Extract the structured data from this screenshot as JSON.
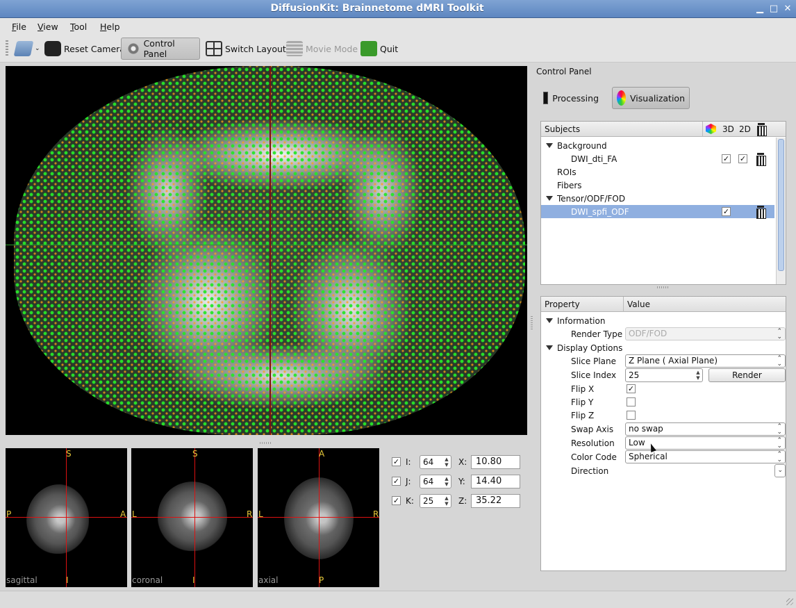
{
  "window": {
    "title": "DiffusionKit: Brainnetome dMRI Toolkit"
  },
  "menu": [
    "File",
    "View",
    "Tool",
    "Help"
  ],
  "toolbar": {
    "reset_camera": "Reset Camera",
    "control_panel": "Control Panel",
    "switch_layout": "Switch Layout",
    "movie_mode": "Movie Mode",
    "quit": "Quit"
  },
  "views": {
    "sagittal": {
      "label": "sagittal",
      "top": "S",
      "bottom": "I",
      "left": "P",
      "right": "A"
    },
    "coronal": {
      "label": "coronal",
      "top": "S",
      "bottom": "I",
      "left": "L",
      "right": "R"
    },
    "axial": {
      "label": "axial",
      "top": "A",
      "bottom": "P",
      "left": "L",
      "right": "R"
    }
  },
  "coords": {
    "i_label": "I:",
    "i_value": "64",
    "x_label": "X:",
    "x_value": "10.80",
    "j_label": "J:",
    "j_value": "64",
    "y_label": "Y:",
    "y_value": "14.40",
    "k_label": "K:",
    "k_value": "25",
    "z_label": "Z:",
    "z_value": "35.22",
    "checked": "✓"
  },
  "control_panel": {
    "title": "Control Panel",
    "processing": "Processing",
    "visualization": "Visualization",
    "subjects": {
      "header": "Subjects",
      "col_3d": "3D",
      "col_2d": "2D",
      "background": "Background",
      "dwi_dti_fa": "DWI_dti_FA",
      "rois": "ROIs",
      "fibers": "Fibers",
      "tensor": "Tensor/ODF/FOD",
      "dwi_spfi_odf": "DWI_spfi_ODF"
    },
    "properties": {
      "col_property": "Property",
      "col_value": "Value",
      "information": "Information",
      "render_type_label": "Render Type",
      "render_type_value": "ODF/FOD",
      "display_options": "Display Options",
      "slice_plane_label": "Slice Plane",
      "slice_plane_value": "Z Plane (   Axial Plane)",
      "slice_index_label": "Slice Index",
      "slice_index_value": "25",
      "render_button": "Render",
      "flip_x_label": "Flip X",
      "flip_y_label": "Flip Y",
      "flip_z_label": "Flip Z",
      "swap_axis_label": "Swap Axis",
      "swap_axis_value": "no swap",
      "resolution_label": "Resolution",
      "resolution_value": "Low",
      "color_code_label": "Color Code",
      "color_code_value": "Spherical",
      "direction_label": "Direction"
    }
  },
  "colors": {
    "titlebar": "#6c93c8",
    "selection": "#8fafe0",
    "crosshair_green": "#2ca02c",
    "crosshair_red": "#d11111",
    "orientation_text": "#e8c83a"
  }
}
